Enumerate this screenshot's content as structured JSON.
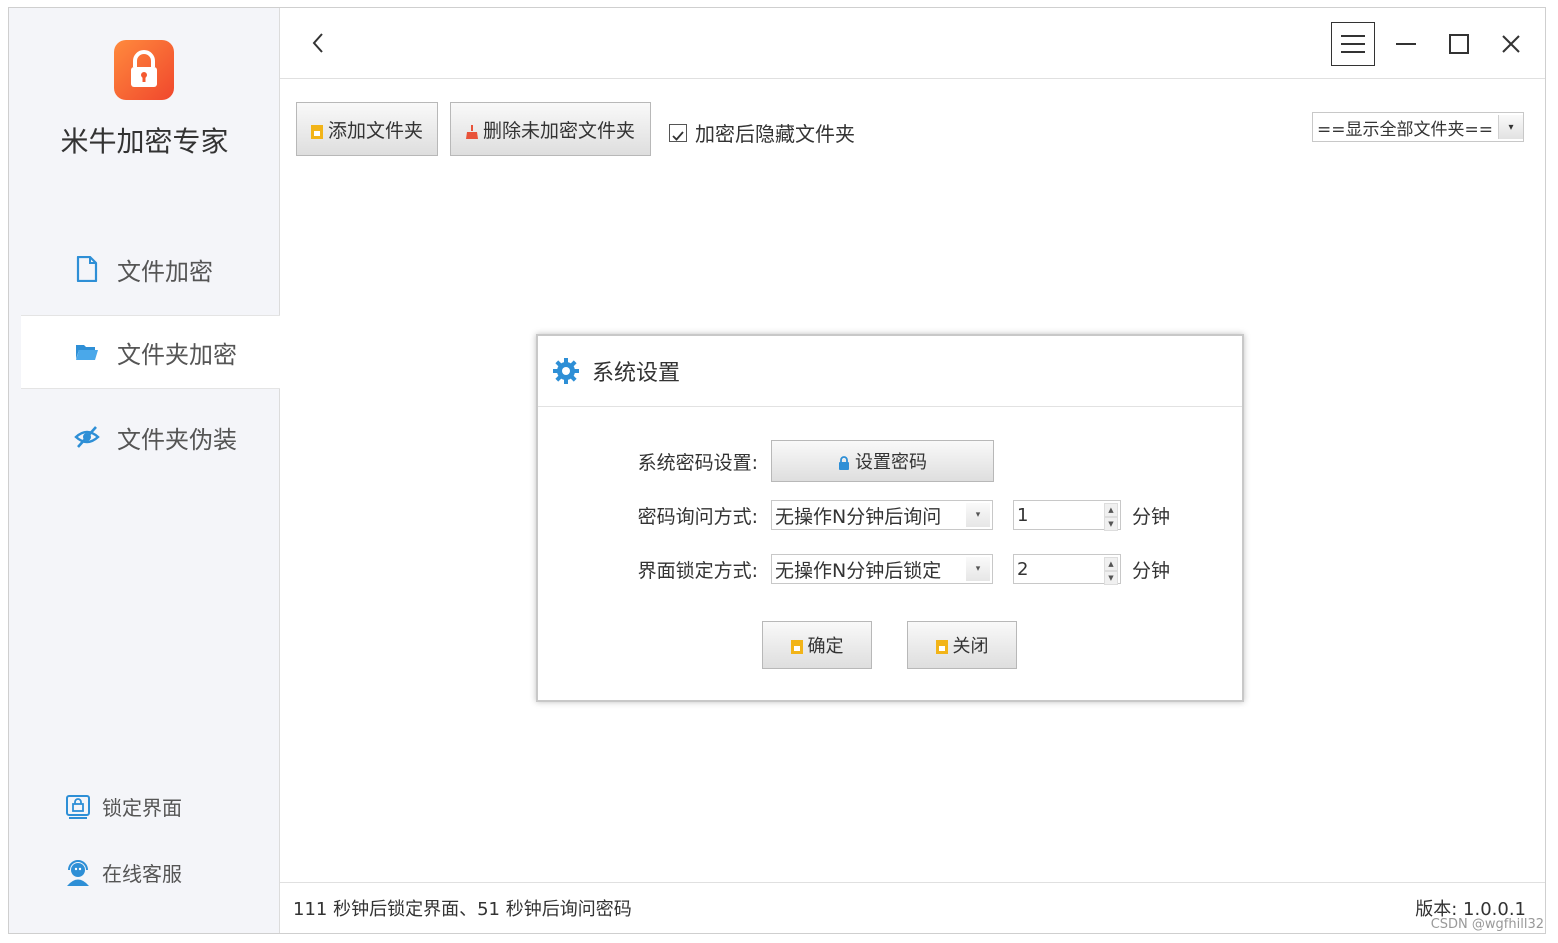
{
  "app": {
    "title": "米牛加密专家"
  },
  "sidebar": {
    "items": [
      {
        "label": "文件加密",
        "icon": "file-icon"
      },
      {
        "label": "文件夹加密",
        "icon": "folder-icon",
        "active": true
      },
      {
        "label": "文件夹伪装",
        "icon": "eye-slash-icon"
      }
    ],
    "footer": [
      {
        "label": "锁定界面",
        "icon": "lock-screen-icon"
      },
      {
        "label": "在线客服",
        "icon": "support-icon"
      }
    ]
  },
  "toolbar": {
    "add_folder_label": "添加文件夹",
    "delete_unencrypted_label": "删除未加密文件夹",
    "hide_after_encrypt_label": "加密后隐藏文件夹",
    "hide_after_encrypt_checked": true,
    "filter_value": "==显示全部文件夹=="
  },
  "dialog": {
    "title": "系统设置",
    "password_label": "系统密码设置:",
    "set_password_button": "设置密码",
    "ask_mode_label": "密码询问方式:",
    "ask_mode_value": "无操作N分钟后询问",
    "ask_minutes": "1",
    "lock_mode_label": "界面锁定方式:",
    "lock_mode_value": "无操作N分钟后锁定",
    "lock_minutes": "2",
    "unit": "分钟",
    "ok_button": "确定",
    "close_button": "关闭"
  },
  "status": {
    "message": "111 秒钟后锁定界面、51 秒钟后询问密码",
    "version": "版本: 1.0.0.1"
  },
  "watermark": "CSDN @wgfhill32",
  "colors": {
    "accent": "#2e8fd6",
    "logo": "#f4592f"
  }
}
